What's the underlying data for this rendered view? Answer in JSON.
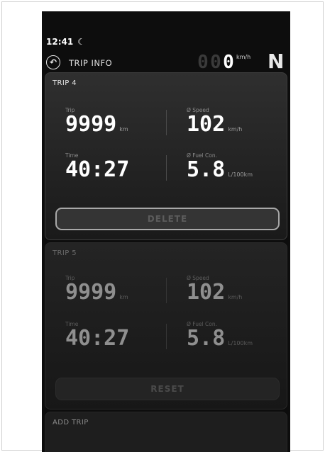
{
  "status": {
    "time": "12:41",
    "moon_glyph": "☾"
  },
  "header": {
    "title": "TRIP INFO",
    "speed_digits": [
      "0",
      "0",
      "0"
    ],
    "speed_unit": "km/h",
    "gear": "N"
  },
  "trips": [
    {
      "name": "TRIP 4",
      "trip_label": "Trip",
      "trip_value": "9999",
      "trip_unit": "km",
      "speed_label": "Ø Speed",
      "speed_value": "102",
      "speed_unit": "km/h",
      "time_label": "Time",
      "time_value": "40:27",
      "fuel_label": "Ø Fuel Con.",
      "fuel_value": "5.8",
      "fuel_unit": "L/100km",
      "button_label": "DELETE"
    },
    {
      "name": "TRIP 5",
      "trip_label": "Trip",
      "trip_value": "9999",
      "trip_unit": "km",
      "speed_label": "Ø Speed",
      "speed_value": "102",
      "speed_unit": "km/h",
      "time_label": "Time",
      "time_value": "40:27",
      "fuel_label": "Ø Fuel Con.",
      "fuel_value": "5.8",
      "fuel_unit": "L/100km",
      "button_label": "RESET"
    }
  ],
  "add_trip": {
    "label": "ADD TRIP"
  },
  "icons": {
    "back": "back-arrow-icon",
    "moon": "moon-icon"
  }
}
